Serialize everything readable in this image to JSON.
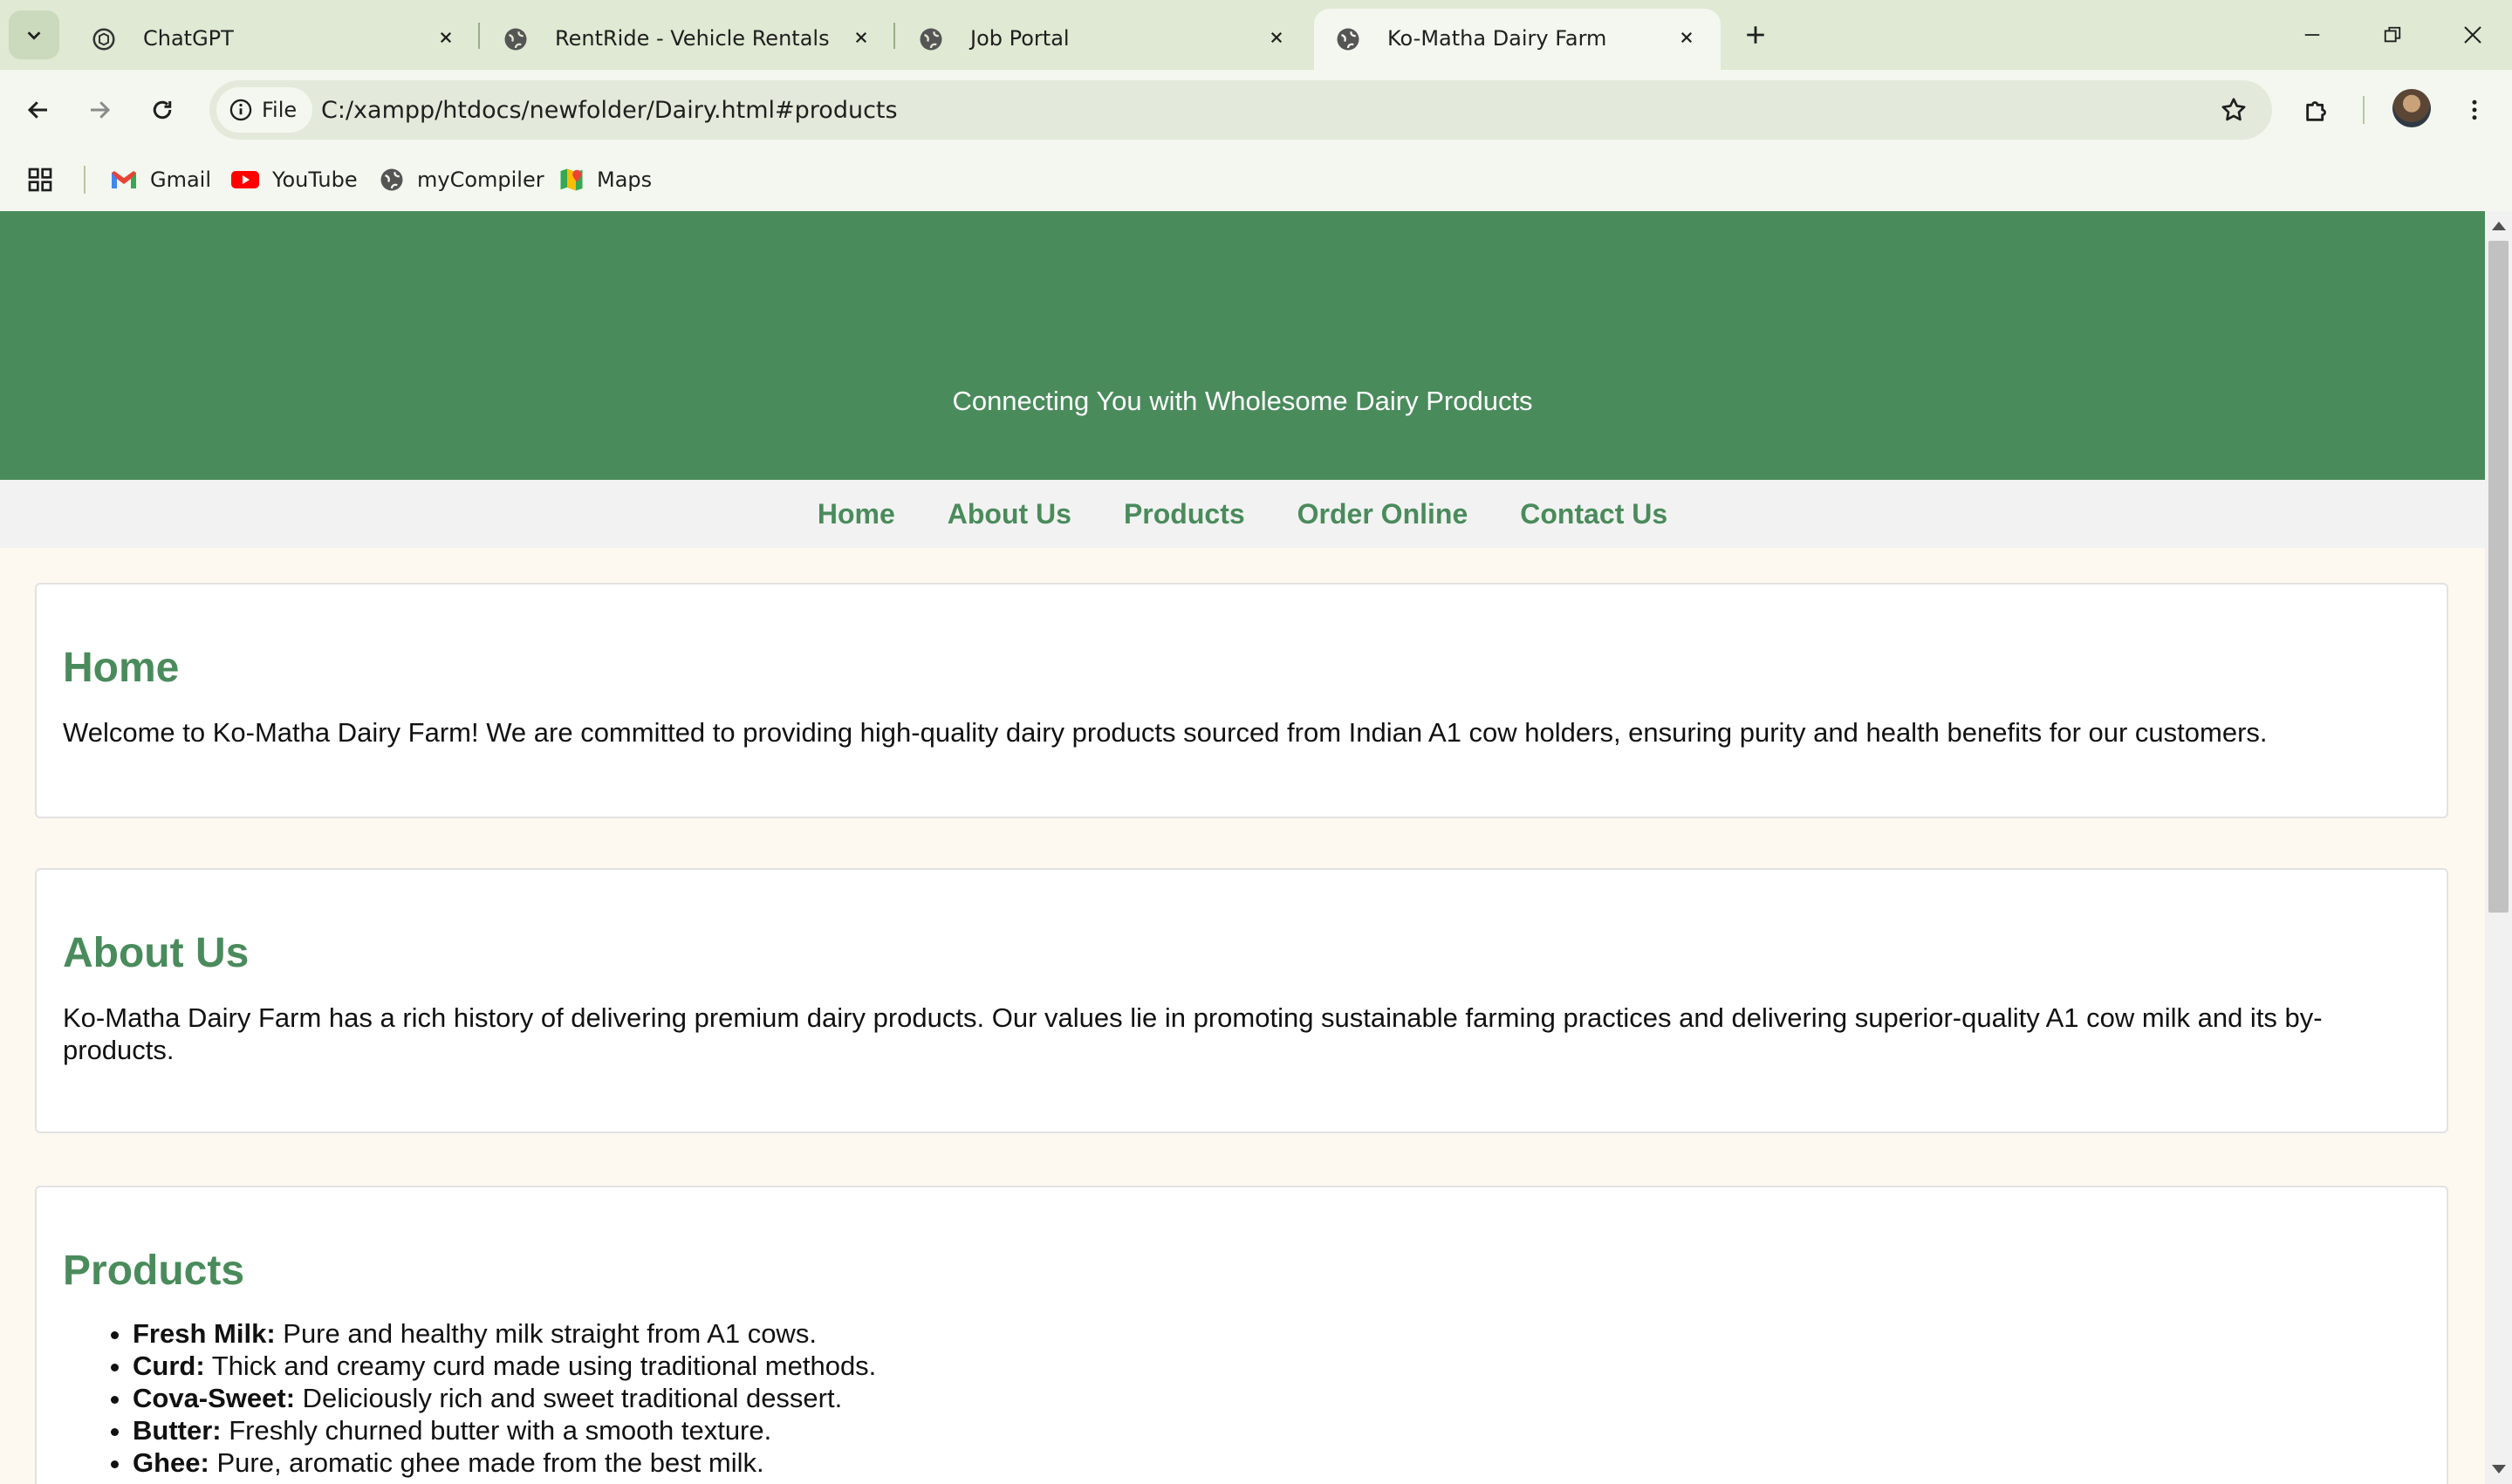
{
  "browser": {
    "tabs": [
      {
        "title": "ChatGPT",
        "icon": "chatgpt-icon"
      },
      {
        "title": "RentRide - Vehicle Rentals",
        "icon": "globe-icon"
      },
      {
        "title": "Job Portal",
        "icon": "globe-icon"
      },
      {
        "title": "Ko-Matha Dairy Farm",
        "icon": "globe-icon",
        "active": true
      }
    ],
    "site_info_label": "File",
    "url": "C:/xampp/htdocs/newfolder/Dairy.html#products",
    "bookmarks": [
      {
        "label": "Gmail",
        "icon": "gmail-icon"
      },
      {
        "label": "YouTube",
        "icon": "youtube-icon"
      },
      {
        "label": "myCompiler",
        "icon": "globe-icon"
      },
      {
        "label": "Maps",
        "icon": "maps-icon"
      }
    ]
  },
  "page": {
    "tagline": "Connecting You with Wholesome Dairy Products",
    "nav": [
      "Home",
      "About Us",
      "Products",
      "Order Online",
      "Contact Us"
    ],
    "home": {
      "heading": "Home",
      "text": "Welcome to Ko-Matha Dairy Farm! We are committed to providing high-quality dairy products sourced from Indian A1 cow holders, ensuring purity and health benefits for our customers."
    },
    "about": {
      "heading": "About Us",
      "text": "Ko-Matha Dairy Farm has a rich history of delivering premium dairy products. Our values lie in promoting sustainable farming practices and delivering superior-quality A1 cow milk and its by-products."
    },
    "products": {
      "heading": "Products",
      "items": [
        {
          "name": "Fresh Milk:",
          "desc": " Pure and healthy milk straight from A1 cows."
        },
        {
          "name": "Curd:",
          "desc": " Thick and creamy curd made using traditional methods."
        },
        {
          "name": "Cova-Sweet:",
          "desc": " Deliciously rich and sweet traditional dessert."
        },
        {
          "name": "Butter:",
          "desc": " Freshly churned butter with a smooth texture."
        },
        {
          "name": "Ghee:",
          "desc": " Pure, aromatic ghee made from the best milk."
        }
      ]
    }
  },
  "colors": {
    "brand_green": "#4a8b5c",
    "page_bg": "#fdf8f0",
    "chrome_bg": "#dfe9d3"
  }
}
